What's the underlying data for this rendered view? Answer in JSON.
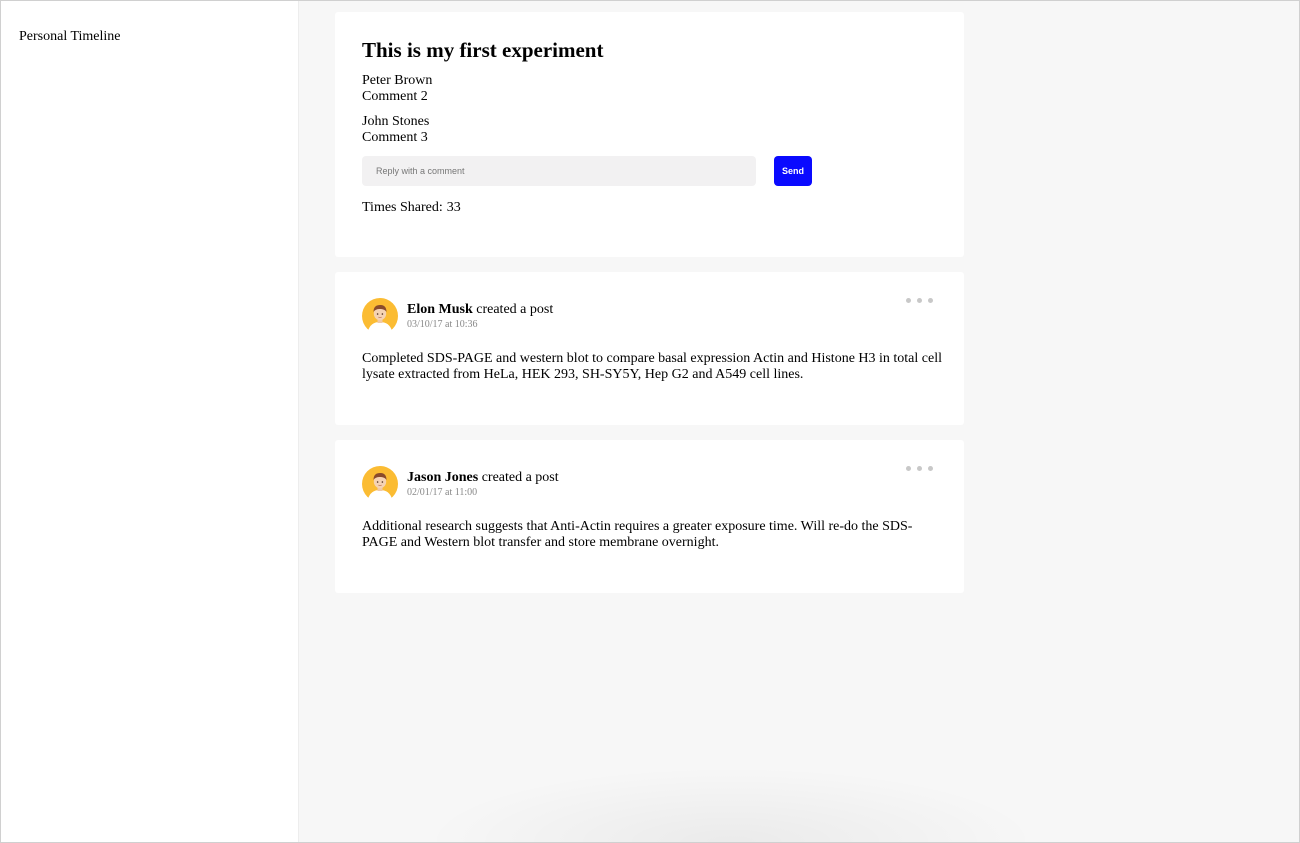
{
  "sidebar": {
    "title": "Personal Timeline"
  },
  "experiment": {
    "title": "This is my first experiment",
    "comments": [
      {
        "author": "Peter Brown",
        "text": "Comment 2"
      },
      {
        "author": "John Stones",
        "text": "Comment 3"
      }
    ],
    "reply": {
      "placeholder": "Reply with a comment",
      "send_label": "Send"
    },
    "shared_label": "Times Shared:",
    "shared_count": "33"
  },
  "posts": [
    {
      "author": "Elon Musk",
      "action": "created a post",
      "timestamp": "03/10/17 at 10:36",
      "body": "Completed SDS-PAGE and western blot to compare basal expression Actin and Histone H3 in total cell lysate extracted from HeLa, HEK 293, SH-SY5Y, Hep G2 and A549 cell lines.",
      "avatar_icon": "user-avatar-icon",
      "menu_icon": "more-options-icon"
    },
    {
      "author": "Jason Jones",
      "action": "created a post",
      "timestamp": "02/01/17 at 11:00",
      "body": "Additional research suggests that Anti-Actin requires a greater exposure time. Will re-do the SDS-PAGE and Western blot transfer and store membrane overnight.",
      "avatar_icon": "user-avatar-icon",
      "menu_icon": "more-options-icon"
    }
  ],
  "colors": {
    "background": "#f7f7f7",
    "card": "#ffffff",
    "send_button": "#0a0aff",
    "avatar_bg": "#fbbc33",
    "timestamp": "#888888"
  }
}
